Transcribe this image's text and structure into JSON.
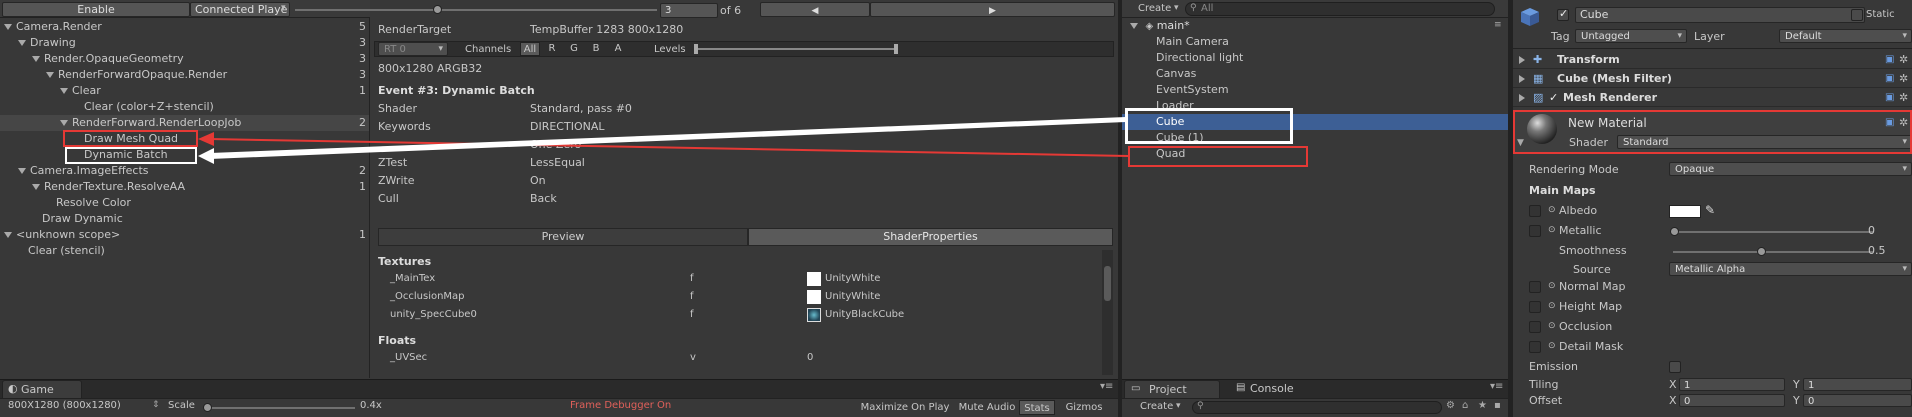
{
  "frame_debugger": {
    "enable_label": "Enable",
    "connected_label": "Connected Playe",
    "frame_index": "3",
    "frame_total": "of 6",
    "prev_arrow": "◀",
    "next_arrow": "▶",
    "events": [
      {
        "label": "Camera.Render",
        "count": "5"
      },
      {
        "label": "Drawing",
        "count": "3"
      },
      {
        "label": "Render.OpaqueGeometry",
        "count": "3"
      },
      {
        "label": "RenderForwardOpaque.Render",
        "count": "3"
      },
      {
        "label": "Clear",
        "count": "1"
      },
      {
        "label": "Clear (color+Z+stencil)",
        "count": ""
      },
      {
        "label": "RenderForward.RenderLoopJob",
        "count": "2"
      },
      {
        "label": "Draw Mesh Quad",
        "count": ""
      },
      {
        "label": "Dynamic Batch",
        "count": ""
      },
      {
        "label": "Camera.ImageEffects",
        "count": "2"
      },
      {
        "label": "RenderTexture.ResolveAA",
        "count": "1"
      },
      {
        "label": "Resolve Color",
        "count": ""
      },
      {
        "label": "Draw Dynamic",
        "count": ""
      },
      {
        "label": "<unknown scope>",
        "count": "1"
      },
      {
        "label": "Clear (stencil)",
        "count": ""
      }
    ],
    "detail": {
      "render_target_label": "RenderTarget",
      "render_target_value": "TempBuffer 1283 800x1280",
      "rt_label": "RT 0",
      "channels_label": "Channels",
      "channels": [
        "All",
        "R",
        "G",
        "B",
        "A"
      ],
      "levels_label": "Levels",
      "format": "800x1280 ARGB32",
      "event_title": "Event #3: Dynamic Batch",
      "props": [
        {
          "k": "Shader",
          "v": "Standard, pass #0"
        },
        {
          "k": "Keywords",
          "v": "DIRECTIONAL"
        },
        {
          "k": "",
          "v": "One Zero"
        },
        {
          "k": "ZTest",
          "v": "LessEqual"
        },
        {
          "k": "ZWrite",
          "v": "On"
        },
        {
          "k": "Cull",
          "v": "Back"
        }
      ],
      "tabs": [
        "Preview",
        "ShaderProperties"
      ],
      "textures_header": "Textures",
      "textures": [
        {
          "name": "_MainTex",
          "flag": "f",
          "value": "UnityWhite"
        },
        {
          "name": "_OcclusionMap",
          "flag": "f",
          "value": "UnityWhite"
        },
        {
          "name": "unity_SpecCube0",
          "flag": "f",
          "value": "UnityBlackCube"
        }
      ],
      "floats_header": "Floats",
      "floats": [
        {
          "name": "_UVSec",
          "flag": "v",
          "value": "0"
        }
      ]
    }
  },
  "game_bar": {
    "tab": "Game",
    "resolution": "800X1280 (800x1280)",
    "scale_label": "Scale",
    "scale_value": "0.4x",
    "frame_debugger_on": "Frame Debugger On",
    "buttons": [
      "Maximize On Play",
      "Mute Audio",
      "Stats",
      "Gizmos"
    ]
  },
  "hierarchy": {
    "create_label": "Create",
    "search_placeholder": "All",
    "scene": "main*",
    "items": [
      "Main Camera",
      "Directional light",
      "Canvas",
      "EventSystem",
      "Loader",
      "Cube",
      "Cube (1)",
      "Quad"
    ]
  },
  "project_bar": {
    "tabs": [
      "Project",
      "Console"
    ],
    "create_label": "Create"
  },
  "inspector": {
    "object_name": "Cube",
    "static_label": "Static",
    "tag_label": "Tag",
    "tag_value": "Untagged",
    "layer_label": "Layer",
    "layer_value": "Default",
    "components": [
      "Transform",
      "Cube (Mesh Filter)",
      "Mesh Renderer"
    ],
    "material_name": "New Material",
    "shader_label": "Shader",
    "shader_value": "Standard",
    "rendering_mode_label": "Rendering Mode",
    "rendering_mode_value": "Opaque",
    "main_maps_label": "Main Maps",
    "albedo_label": "Albedo",
    "metallic_label": "Metallic",
    "metallic_value": "0",
    "smoothness_label": "Smoothness",
    "smoothness_value": "0.5",
    "source_label": "Source",
    "source_value": "Metallic Alpha",
    "normal_map_label": "Normal Map",
    "height_map_label": "Height Map",
    "occlusion_label": "Occlusion",
    "detail_mask_label": "Detail Mask",
    "emission_label": "Emission",
    "tiling_label": "Tiling",
    "offset_label": "Offset",
    "tiling_x": "1",
    "tiling_y": "1",
    "offset_x": "0",
    "offset_y": "0",
    "x_label": "X",
    "y_label": "Y"
  },
  "colors": {
    "highlight_red": "#e53935",
    "selection_blue": "#3d5f95",
    "annotation_white": "#ffffff"
  }
}
